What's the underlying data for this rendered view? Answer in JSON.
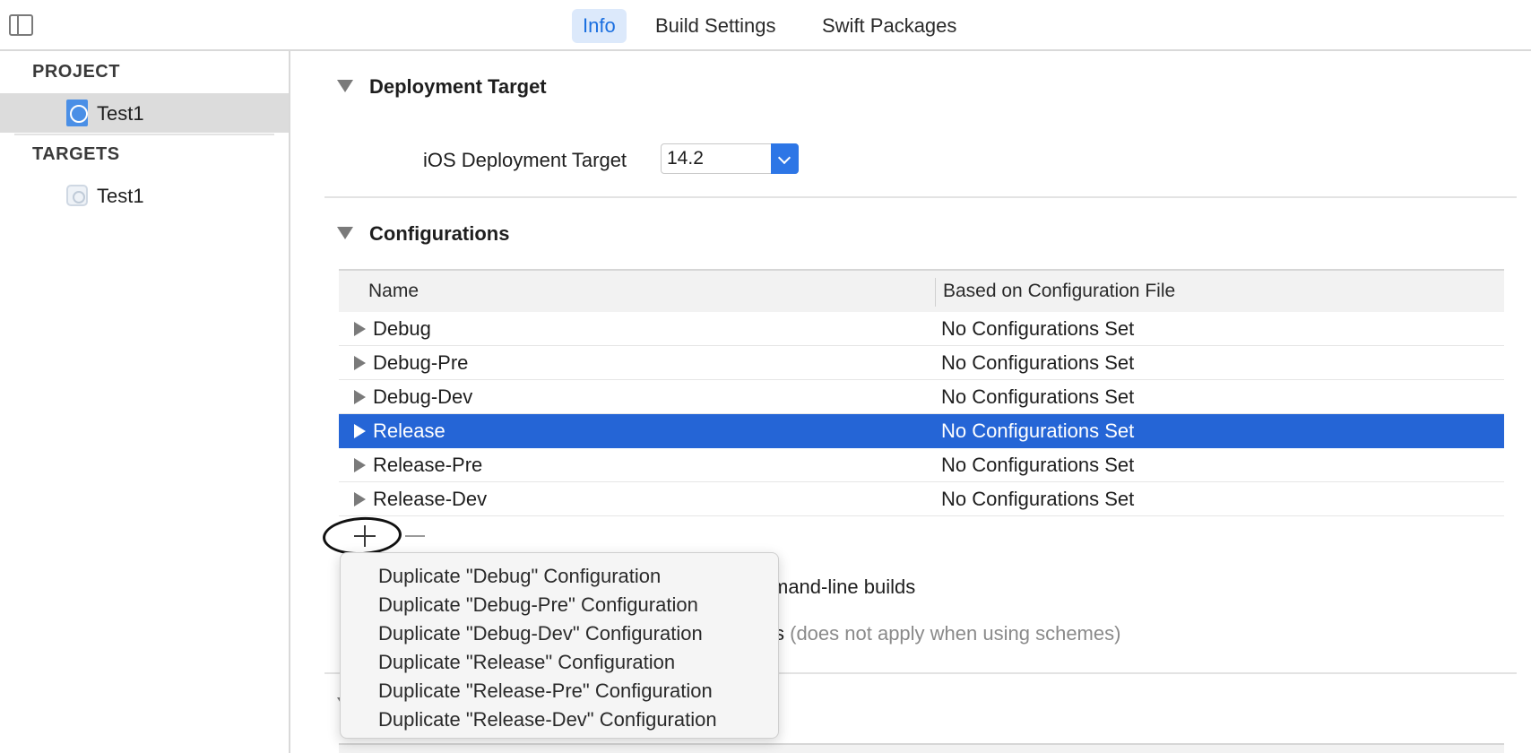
{
  "toolbar": {
    "tabs": [
      {
        "label": "Info",
        "active": true
      },
      {
        "label": "Build Settings",
        "active": false
      },
      {
        "label": "Swift Packages",
        "active": false
      }
    ]
  },
  "sidebar": {
    "project_heading": "PROJECT",
    "project_item": "Test1",
    "targets_heading": "TARGETS",
    "target_item": "Test1"
  },
  "deployment": {
    "section_title": "Deployment Target",
    "label": "iOS Deployment Target",
    "value": "14.2"
  },
  "configurations": {
    "section_title": "Configurations",
    "columns": [
      "Name",
      "Based on Configuration File"
    ],
    "rows": [
      {
        "name": "Debug",
        "file": "No Configurations Set",
        "selected": false
      },
      {
        "name": "Debug-Pre",
        "file": "No Configurations Set",
        "selected": false
      },
      {
        "name": "Debug-Dev",
        "file": "No Configurations Set",
        "selected": false
      },
      {
        "name": "Release",
        "file": "No Configurations Set",
        "selected": true
      },
      {
        "name": "Release-Pre",
        "file": "No Configurations Set",
        "selected": false
      },
      {
        "name": "Release-Dev",
        "file": "No Configurations Set",
        "selected": false
      }
    ],
    "partial_text_1": "mand-line builds",
    "partial_text_2_prefix": "s",
    "partial_text_2_muted": "(does not apply when using schemes)"
  },
  "menu": {
    "items": [
      "Duplicate \"Debug\" Configuration",
      "Duplicate \"Debug-Pre\" Configuration",
      "Duplicate \"Debug-Dev\" Configuration",
      "Duplicate \"Release\" Configuration",
      "Duplicate \"Release-Pre\" Configuration",
      "Duplicate \"Release-Dev\" Configuration"
    ]
  },
  "colors": {
    "accent": "#2565d6",
    "tab_active_bg": "#dce9fb",
    "tab_active_text": "#1a6fe0",
    "annotation": "#111111"
  }
}
